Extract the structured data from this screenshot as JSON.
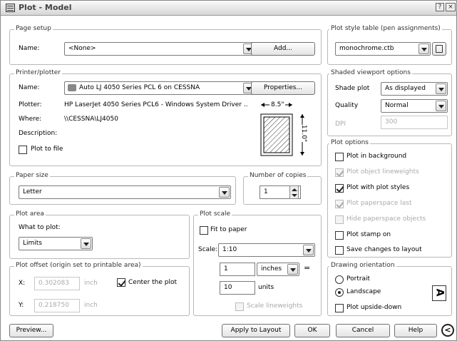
{
  "window": {
    "title": "Plot - Model"
  },
  "page_setup": {
    "group": "Page setup",
    "name_label": "Name:",
    "name_value": "<None>",
    "add_button": "Add..."
  },
  "printer": {
    "group": "Printer/plotter",
    "name_label": "Name:",
    "name_value": "Auto LJ 4050 Series PCL 6 on CESSNA",
    "properties_button": "Properties...",
    "plotter_label": "Plotter:",
    "plotter_value": "HP LaserJet 4050 Series PCL6 - Windows System Driver ...",
    "where_label": "Where:",
    "where_value": "\\\\CESSNA\\LJ4050",
    "description_label": "Description:",
    "plot_to_file": "Plot to file",
    "preview_width": "8.5\"",
    "preview_height": "11.0\""
  },
  "paper_size": {
    "group": "Paper size",
    "value": "Letter"
  },
  "copies": {
    "group": "Number of copies",
    "value": "1"
  },
  "plot_area": {
    "group": "Plot area",
    "what_label": "What to plot:",
    "value": "Limits"
  },
  "plot_offset": {
    "group": "Plot offset (origin set to printable area)",
    "x_label": "X:",
    "x_value": "0.302083",
    "x_unit": "inch",
    "y_label": "Y:",
    "y_value": "0.218750",
    "y_unit": "inch",
    "center": "Center the plot"
  },
  "plot_scale": {
    "group": "Plot scale",
    "fit": "Fit to paper",
    "scale_label": "Scale:",
    "scale_value": "1:10",
    "num": "1",
    "units_value": "inches",
    "equals": "=",
    "den": "10",
    "den_unit": "units",
    "lineweights": "Scale lineweights"
  },
  "style_table": {
    "group": "Plot style table (pen assignments)",
    "value": "monochrome.ctb"
  },
  "shaded": {
    "group": "Shaded viewport options",
    "shade_label": "Shade plot",
    "shade_value": "As displayed",
    "quality_label": "Quality",
    "quality_value": "Normal",
    "dpi_label": "DPI",
    "dpi_value": "300"
  },
  "plot_options": {
    "group": "Plot options",
    "background": "Plot in background",
    "object_lw": "Plot object lineweights",
    "with_styles": "Plot with plot styles",
    "paperspace_last": "Plot paperspace last",
    "hide_paperspace": "Hide paperspace objects",
    "stamp": "Plot stamp on",
    "save_changes": "Save changes to layout"
  },
  "orientation": {
    "group": "Drawing orientation",
    "portrait": "Portrait",
    "landscape": "Landscape",
    "upside_down": "Plot upside-down"
  },
  "footer": {
    "preview": "Preview...",
    "apply": "Apply to Layout",
    "ok": "OK",
    "cancel": "Cancel",
    "help": "Help"
  }
}
